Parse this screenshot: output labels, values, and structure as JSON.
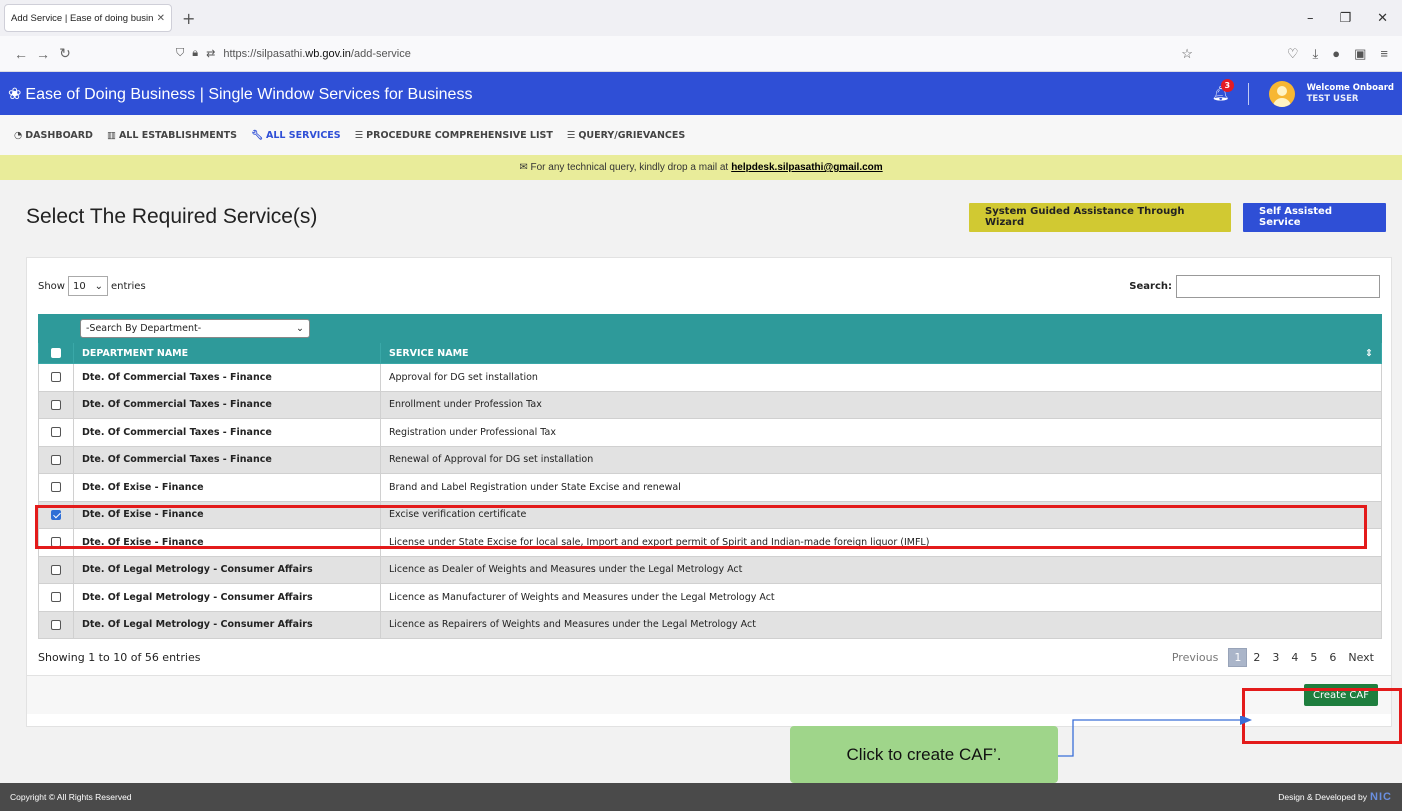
{
  "browser": {
    "tab_title": "Add Service | Ease of doing business",
    "url_host": "https://silpasathi.",
    "url_domain": "wb.gov.in",
    "url_path": "/add-service"
  },
  "header": {
    "title": "Ease of Doing Business | Single Window Services for Business",
    "notification_count": "3",
    "welcome": "Welcome Onboard",
    "user": "TEST USER"
  },
  "nav": {
    "items": [
      {
        "label": "DASHBOARD",
        "icon": "dashboard-icon"
      },
      {
        "label": "ALL ESTABLISHMENTS",
        "icon": "building-icon"
      },
      {
        "label": "ALL SERVICES",
        "icon": "wrench-icon"
      },
      {
        "label": "PROCEDURE COMPREHENSIVE LIST",
        "icon": "list-icon"
      },
      {
        "label": "QUERY/GRIEVANCES",
        "icon": "list-icon"
      }
    ]
  },
  "notice": {
    "text": "For any technical query, kindly drop a mail at",
    "email": "helpdesk.silpasathi@gmail.com"
  },
  "page": {
    "title": "Select The Required Service(s)",
    "wizard_button": "System Guided Assistance Through Wizard",
    "self_button": "Self Assisted Service"
  },
  "table": {
    "show_label": "Show",
    "length_value": "10",
    "entries_label": "entries",
    "search_label": "Search:",
    "dept_filter": "-Search By Department-",
    "col_dept": "DEPARTMENT NAME",
    "col_service": "SERVICE NAME",
    "rows": [
      {
        "dept": "Dte. Of Commercial Taxes - Finance",
        "service": "Approval for DG set installation",
        "checked": false
      },
      {
        "dept": "Dte. Of Commercial Taxes - Finance",
        "service": "Enrollment under Profession Tax",
        "checked": false
      },
      {
        "dept": "Dte. Of Commercial Taxes - Finance",
        "service": "Registration under Professional Tax",
        "checked": false
      },
      {
        "dept": "Dte. Of Commercial Taxes - Finance",
        "service": "Renewal of Approval for DG set installation",
        "checked": false
      },
      {
        "dept": "Dte. Of Exise - Finance",
        "service": "Brand and Label Registration under State Excise and renewal",
        "checked": false
      },
      {
        "dept": "Dte. Of Exise - Finance",
        "service": "Excise verification certificate",
        "checked": true
      },
      {
        "dept": "Dte. Of Exise - Finance",
        "service": "License under State Excise for local sale, Import and export permit of Spirit and Indian-made foreign liquor (IMFL)",
        "checked": false
      },
      {
        "dept": "Dte. Of Legal Metrology - Consumer Affairs",
        "service": "Licence as Dealer of Weights and Measures under the Legal Metrology Act",
        "checked": false
      },
      {
        "dept": "Dte. Of Legal Metrology - Consumer Affairs",
        "service": "Licence as Manufacturer of Weights and Measures under the Legal Metrology Act",
        "checked": false
      },
      {
        "dept": "Dte. Of Legal Metrology - Consumer Affairs",
        "service": "Licence as Repairers of Weights and Measures under the Legal Metrology Act",
        "checked": false
      }
    ],
    "info": "Showing 1 to 10 of 56 entries",
    "pager": {
      "previous": "Previous",
      "pages": [
        "1",
        "2",
        "3",
        "4",
        "5",
        "6"
      ],
      "next": "Next"
    }
  },
  "create_caf": "Create CAF",
  "callout": "Click to create CAF’.",
  "footer": {
    "copyright": "Copyright © All Rights Reserved",
    "designed": "Design & Developed by",
    "logo": "NIC"
  },
  "colors": {
    "header_blue": "#2f4fd6",
    "table_teal": "#2e9a9a",
    "wizard_yellow": "#d1c932",
    "caf_green": "#1e7e3e",
    "highlight_red": "#e31b1b"
  }
}
